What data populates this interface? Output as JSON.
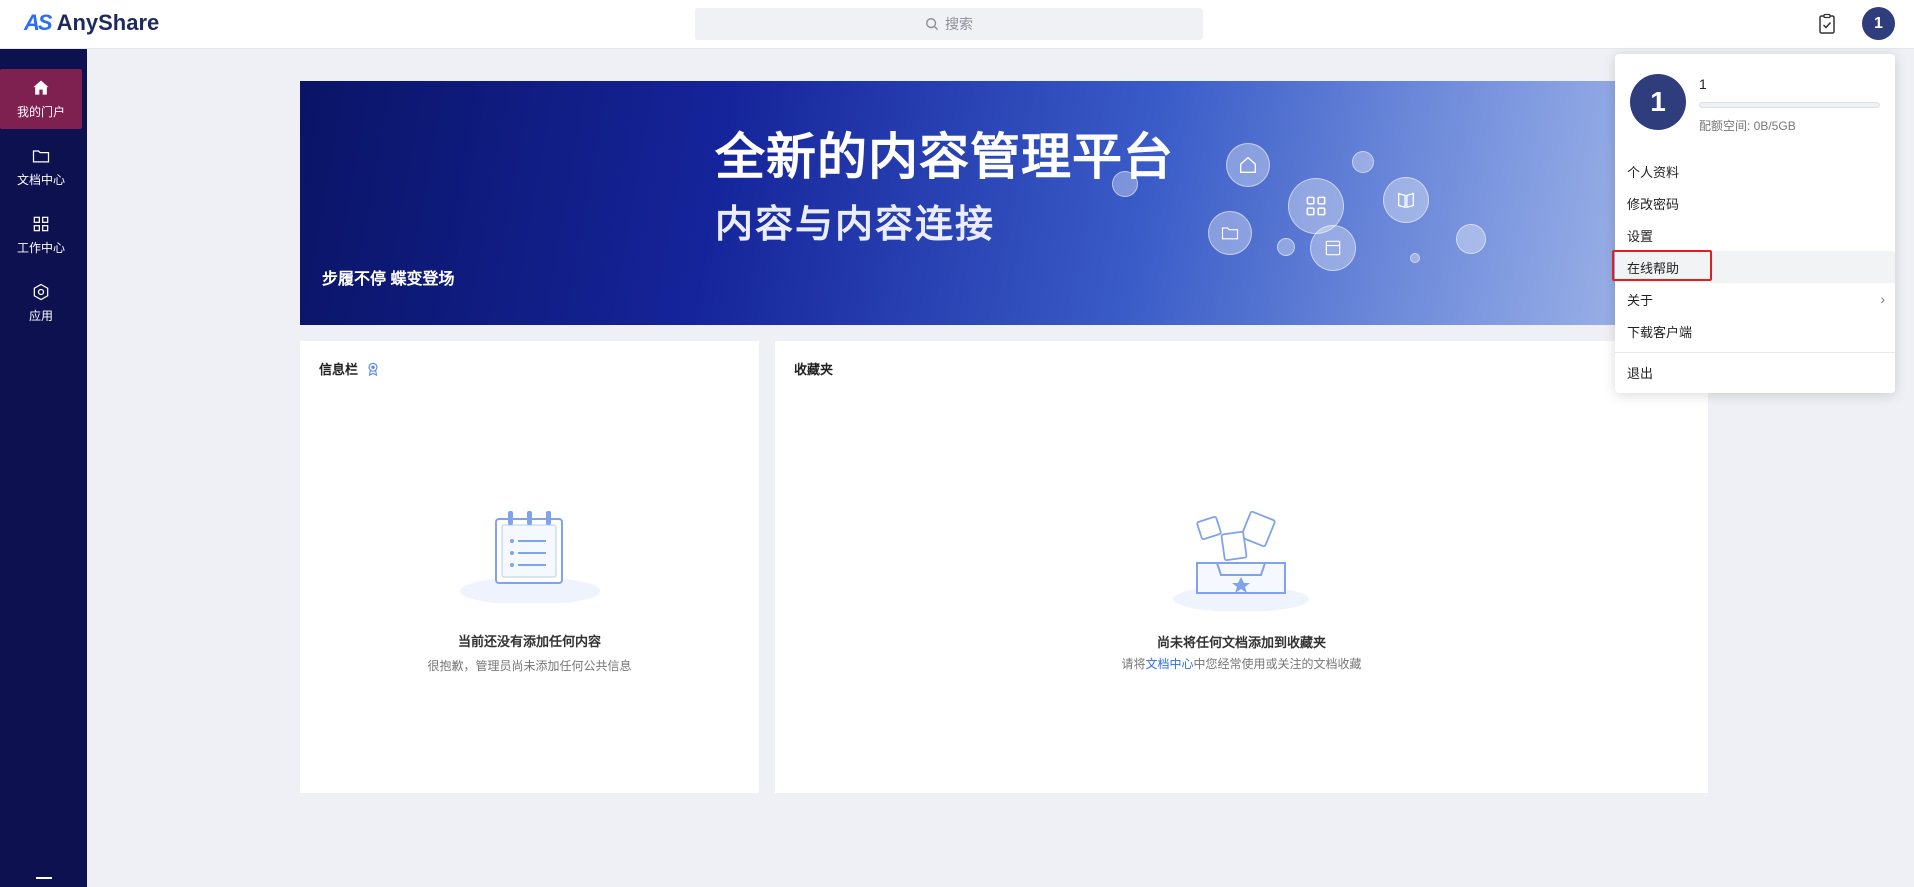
{
  "header": {
    "logo_mark": "AS",
    "logo_text": "AnyShare",
    "search_placeholder": "搜索",
    "avatar_letter": "1"
  },
  "sidebar": {
    "items": [
      {
        "label": "我的门户",
        "icon": "home-icon",
        "active": true
      },
      {
        "label": "文档中心",
        "icon": "folder-icon",
        "active": false
      },
      {
        "label": "工作中心",
        "icon": "grid-icon",
        "active": false
      },
      {
        "label": "应用",
        "icon": "app-hexagon-icon",
        "active": false
      }
    ]
  },
  "banner": {
    "title": "全新的内容管理平台",
    "subtitle": "内容与内容连接",
    "tagline": "步履不停 蝶变登场"
  },
  "info_card": {
    "title": "信息栏",
    "empty_title": "当前还没有添加任何内容",
    "empty_desc": "很抱歉，管理员尚未添加任何公共信息"
  },
  "favorites_card": {
    "title": "收藏夹",
    "empty_title": "尚未将任何文档添加到收藏夹",
    "empty_desc_prefix": "请将",
    "empty_desc_link": "文档中心",
    "empty_desc_suffix": "中您经常使用或关注的文档收藏"
  },
  "user_menu": {
    "avatar_letter": "1",
    "user_name": "1",
    "quota_used_fraction": 0,
    "quota_text": "配额空间: 0B/5GB",
    "items": [
      {
        "label": "个人资料"
      },
      {
        "label": "修改密码"
      },
      {
        "label": "设置"
      },
      {
        "label": "在线帮助"
      },
      {
        "label": "关于"
      },
      {
        "label": "下载客户端"
      }
    ],
    "logout_label": "退出"
  },
  "colors": {
    "sidebar_bg": "#0d1150",
    "sidebar_active": "#7f2150",
    "accent": "#2c6ef2",
    "avatar_bg": "#2f3d7c",
    "highlight_box": "#e02020"
  }
}
